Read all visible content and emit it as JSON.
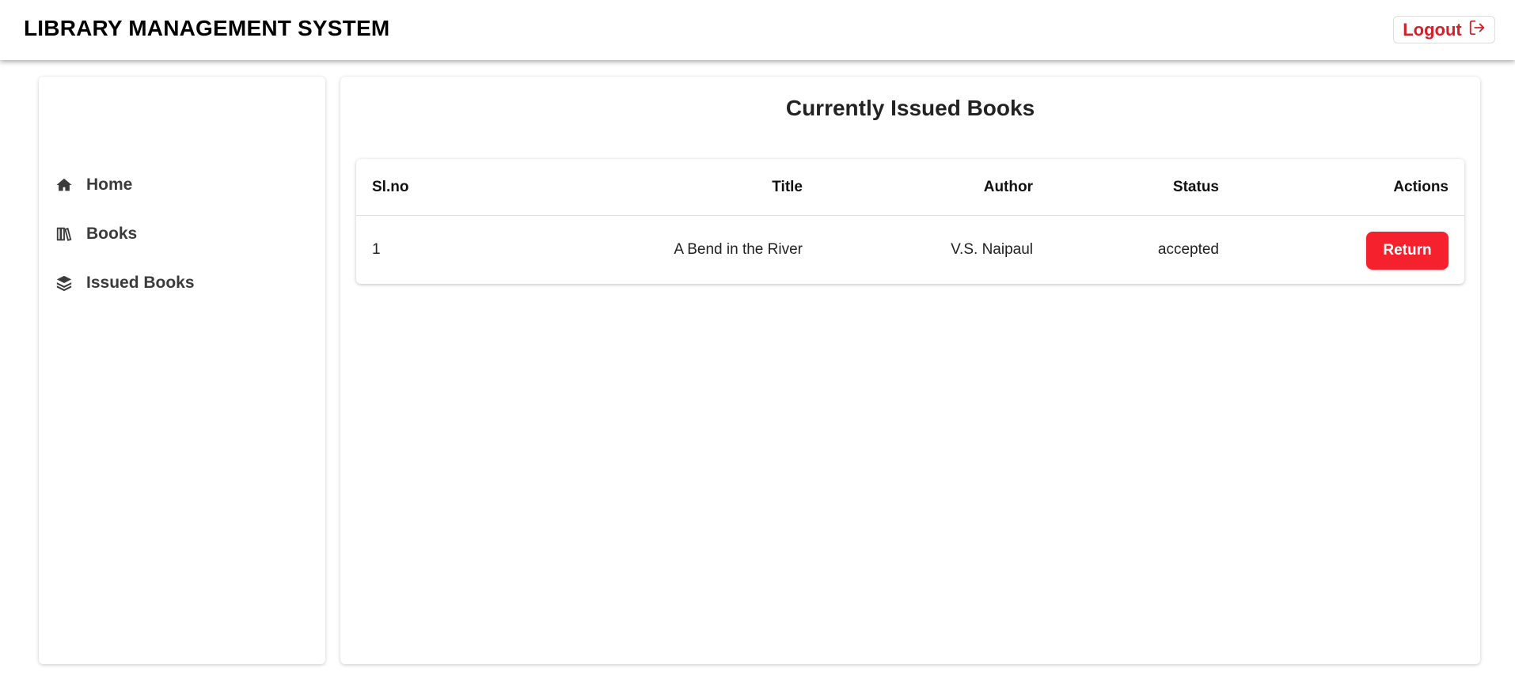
{
  "header": {
    "app_title": "LIBRARY MANAGEMENT SYSTEM",
    "logout_label": "Logout",
    "logout_icon": "logout-icon"
  },
  "sidebar": {
    "items": [
      {
        "label": "Home",
        "icon": "home-icon"
      },
      {
        "label": "Books",
        "icon": "books-icon"
      },
      {
        "label": "Issued Books",
        "icon": "stack-icon"
      }
    ]
  },
  "main": {
    "title": "Currently Issued Books",
    "table": {
      "columns": [
        "Sl.no",
        "Title",
        "Author",
        "Status",
        "Actions"
      ],
      "rows": [
        {
          "sl_no": "1",
          "title": "A Bend in the River",
          "author": "V.S. Naipaul",
          "status": "accepted",
          "action_label": "Return"
        }
      ]
    }
  },
  "colors": {
    "accent_red": "#f5222d",
    "logout_red": "#d32029"
  }
}
